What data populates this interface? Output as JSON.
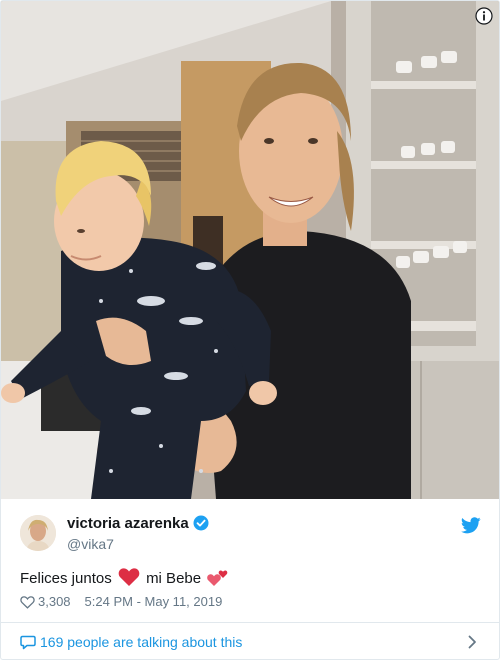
{
  "tweet": {
    "author_name": "victoria azarenka",
    "author_handle": "@vika7",
    "text_part1": "Felices juntos",
    "text_part2": "mi Bebe",
    "likes": "3,308",
    "timestamp": "5:24 PM - May 11, 2019",
    "conversation_text": "169 people are talking about this"
  },
  "icons": {
    "info": "info-icon",
    "verified": "verified-badge-icon",
    "twitter": "twitter-bird-icon",
    "heart": "heart-icon",
    "speech": "speech-bubble-icon",
    "chevron": "chevron-right-icon",
    "emoji1": "red-heart-emoji",
    "emoji2": "two-hearts-emoji"
  },
  "colors": {
    "accent": "#1b95e0",
    "text": "#14171a",
    "muted": "#657786",
    "border": "#e1e8ed"
  }
}
